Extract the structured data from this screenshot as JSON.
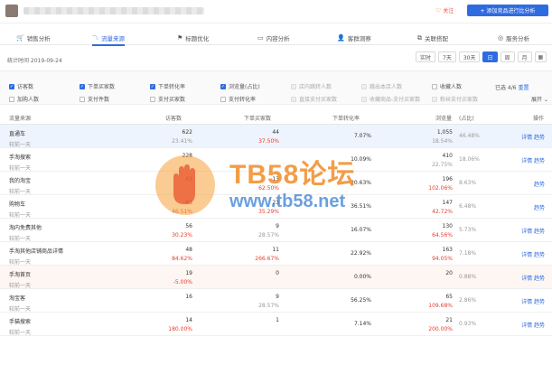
{
  "header": {
    "follow_label": "关注",
    "cta_label": "+ 添加竞品进行比分析",
    "colors": {
      "accent": "#2f6be0",
      "red": "#e63c2e"
    }
  },
  "tabs": [
    {
      "label": "销售分析",
      "icon": "cart-icon"
    },
    {
      "label": "流量来源",
      "icon": "trend-icon",
      "active": true
    },
    {
      "label": "标题优化",
      "icon": "flag-icon"
    },
    {
      "label": "内容分析",
      "icon": "document-icon"
    },
    {
      "label": "客群洞察",
      "icon": "user-icon"
    },
    {
      "label": "关联搭配",
      "icon": "link-icon"
    },
    {
      "label": "服务分析",
      "icon": "service-icon"
    }
  ],
  "stat": {
    "time_label": "统计时间 2019-09-24",
    "periods": [
      "实时",
      "7天",
      "30天",
      "日",
      "周",
      "月"
    ],
    "active_period": "日"
  },
  "filters": {
    "row1": [
      {
        "label": "访客数",
        "checked": true
      },
      {
        "label": "下单买家数",
        "checked": true
      },
      {
        "label": "下单转化率",
        "checked": true
      },
      {
        "label": "浏览量(占比)",
        "checked": true
      },
      {
        "label": "店内跳转人数",
        "checked": false,
        "disabled": true
      },
      {
        "label": "跳出本店人数",
        "checked": false,
        "disabled": true
      },
      {
        "label": "收藏人数",
        "checked": false
      }
    ],
    "row2": [
      {
        "label": "加购人数",
        "checked": false
      },
      {
        "label": "支付件数",
        "checked": false
      },
      {
        "label": "支付买家数",
        "checked": false
      },
      {
        "label": "支付转化率",
        "checked": false
      },
      {
        "label": "直接支付买家数",
        "checked": false,
        "disabled": true
      },
      {
        "label": "收藏商品-支付买家数",
        "checked": false,
        "disabled": true
      },
      {
        "label": "粉丝支付买家数",
        "checked": false,
        "disabled": true
      }
    ],
    "chosen_prefix": "已选 4/6",
    "reset_label": "重置",
    "expand_label": "展开 ⌄"
  },
  "table": {
    "headers": [
      "流量来源",
      "访客数",
      "下单买家数",
      "下单转化率",
      "浏览量",
      "(占比)",
      "操作"
    ],
    "rows": [
      {
        "source": "直通车",
        "sub": "较前一天",
        "visitors": "622",
        "visitors_d": "23.41%",
        "buyers": "44",
        "buyers_d": "37.50%",
        "buyers_red": true,
        "conv": "7.07%",
        "pv": "1,055",
        "pv_d": "18.54%",
        "share": "46.48%",
        "op": "详情 趋势",
        "hl": "blue"
      },
      {
        "source": "手淘搜索",
        "sub": "较前一天",
        "visitors": "228",
        "visitors_d": "",
        "buyers": "",
        "buyers_d": "",
        "conv": "10.09%",
        "pv": "410",
        "pv_d": "22.75%",
        "share": "18.06%",
        "op": "详情 趋势"
      },
      {
        "source": "我的淘宝",
        "sub": "较前一天",
        "visitors": "63",
        "visitors_d": "",
        "buyers": "13",
        "buyers_d": "62.50%",
        "buyers_red": true,
        "conv": "20.63%",
        "pv": "196",
        "pv_d": "102.06%",
        "pv_red": true,
        "share": "8.63%",
        "op": "趋势"
      },
      {
        "source": "购物车",
        "sub": "较前一天",
        "visitors": "63",
        "visitors_d": "46.51%",
        "visitors_red": true,
        "buyers": "23",
        "buyers_d": "35.29%",
        "buyers_red": true,
        "conv": "36.51%",
        "pv": "147",
        "pv_d": "42.72%",
        "pv_red": true,
        "share": "6.48%",
        "op": "趋势"
      },
      {
        "source": "淘内免费其他",
        "sub": "较前一天",
        "visitors": "56",
        "visitors_d": "30.23%",
        "visitors_red": true,
        "buyers": "9",
        "buyers_d": "28.57%",
        "conv": "16.07%",
        "pv": "130",
        "pv_d": "64.56%",
        "pv_red": true,
        "share": "5.73%",
        "op": "详情 趋势"
      },
      {
        "source": "手淘其他店铺商品详情",
        "sub": "较前一天",
        "visitors": "48",
        "visitors_d": "84.62%",
        "visitors_red": true,
        "buyers": "11",
        "buyers_d": "266.67%",
        "buyers_red": true,
        "conv": "22.92%",
        "pv": "163",
        "pv_d": "94.05%",
        "pv_red": true,
        "share": "7.18%",
        "op": "详情 趋势"
      },
      {
        "source": "手淘首页",
        "sub": "较前一天",
        "visitors": "19",
        "visitors_d": "-5.00%",
        "visitors_red": true,
        "buyers": "0",
        "buyers_d": "",
        "conv": "0.00%",
        "pv": "20",
        "pv_d": "",
        "share": "0.88%",
        "op": "详情 趋势",
        "hl": "pink"
      },
      {
        "source": "淘宝客",
        "sub": "较前一天",
        "visitors": "16",
        "visitors_d": "",
        "buyers": "9",
        "buyers_d": "28.57%",
        "conv": "56.25%",
        "pv": "65",
        "pv_d": "109.68%",
        "pv_red": true,
        "share": "2.86%",
        "op": "详情 趋势"
      },
      {
        "source": "手猫搜索",
        "sub": "较前一天",
        "visitors": "14",
        "visitors_d": "180.00%",
        "visitors_red": true,
        "buyers": "1",
        "buyers_d": "",
        "conv": "7.14%",
        "pv": "21",
        "pv_d": "200.00%",
        "pv_red": true,
        "share": "0.93%",
        "op": "详情 趋势"
      }
    ]
  },
  "watermark": {
    "title": "TB58论坛",
    "url": "www.tb58.net"
  }
}
